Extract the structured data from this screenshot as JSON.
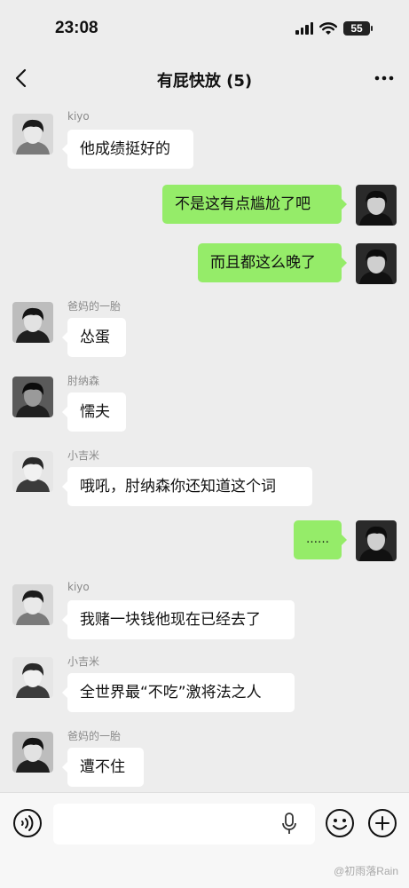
{
  "status_bar": {
    "time": "23:08",
    "battery": "55"
  },
  "nav": {
    "title": "有屁快放 (5)"
  },
  "messages": [
    {
      "side": "in",
      "sender": "kiyo",
      "text": "他成绩挺好的",
      "avatar": "avatar-kiyo"
    },
    {
      "side": "out",
      "sender": "",
      "text": "不是这有点尴尬了吧",
      "avatar": "avatar-self"
    },
    {
      "side": "out",
      "sender": "",
      "text": "而且都这么晚了",
      "avatar": "avatar-self"
    },
    {
      "side": "in",
      "sender": "爸妈的一胎",
      "text": "怂蛋",
      "avatar": "avatar-bamadeyitai"
    },
    {
      "side": "in",
      "sender": "肘纳森",
      "text": "懦夫",
      "avatar": "avatar-zhounasen"
    },
    {
      "side": "in",
      "sender": "小吉米",
      "text": "哦吼，肘纳森你还知道这个词",
      "avatar": "avatar-xiaojimi"
    },
    {
      "side": "out",
      "sender": "",
      "text": "……",
      "avatar": "avatar-self"
    },
    {
      "side": "in",
      "sender": "kiyo",
      "text": "我赌一块钱他现在已经去了",
      "avatar": "avatar-kiyo"
    },
    {
      "side": "in",
      "sender": "小吉米",
      "text": "全世界最“不吃”激将法之人",
      "avatar": "avatar-xiaojimi"
    },
    {
      "side": "in",
      "sender": "爸妈的一胎",
      "text": "遭不住",
      "avatar": "avatar-bamadeyitai"
    }
  ],
  "input": {
    "placeholder": ""
  },
  "watermark": "@初雨落Rain",
  "colors": {
    "background": "#ededed",
    "outgoing_bubble": "#95ec69",
    "incoming_bubble": "#ffffff",
    "input_bar": "#f7f7f7"
  },
  "icons": {
    "back": "chevron-left-icon",
    "more": "more-icon",
    "voice": "voice-icon",
    "mic": "microphone-icon",
    "emoji": "emoji-icon",
    "plus": "plus-icon"
  }
}
